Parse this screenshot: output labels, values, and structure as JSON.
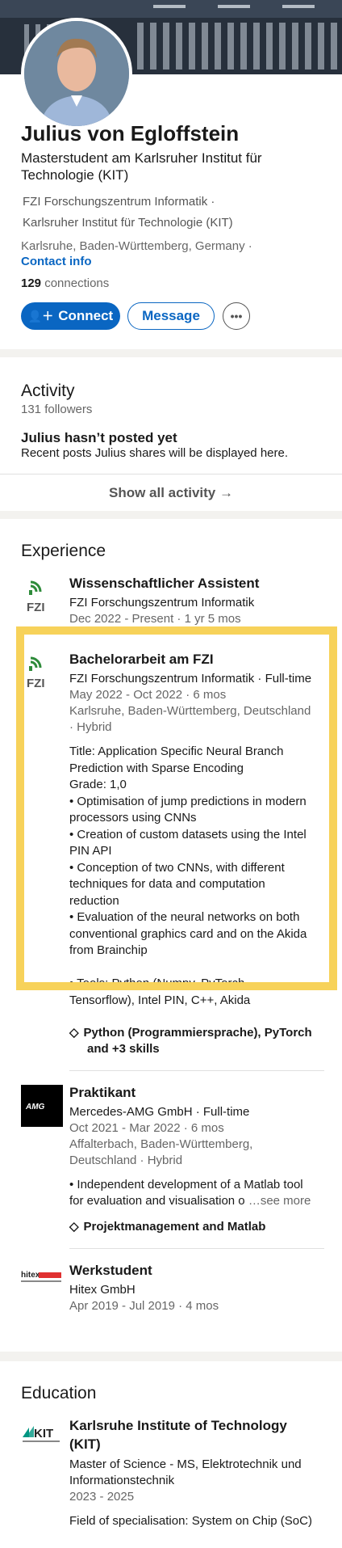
{
  "profile": {
    "name": "Julius von Egloffstein",
    "headline": "Masterstudent am Karlsruher Institut für Technologie (KIT)",
    "org1": "FZI Forschungszentrum Informatik ·",
    "org2": "Karlsruher Institut für Technologie (KIT)",
    "location": "Karlsruhe, Baden-Württemberg, Germany ·",
    "contact_info": "Contact info",
    "connections_count": "129",
    "connections_label": "connections",
    "connect_label": "Connect",
    "message_label": "Message",
    "more_label": "•••"
  },
  "activity": {
    "title": "Activity",
    "followers": "131 followers",
    "empty_title": "Julius hasn’t posted yet",
    "empty_desc": "Recent posts Julius shares will be displayed here.",
    "show_all": "Show all activity →"
  },
  "experience": {
    "title": "Experience",
    "items": [
      {
        "logo": "FZI",
        "title": "Wissenschaftlicher Assistent",
        "company": "FZI Forschungszentrum Informatik",
        "dates": "Dec 2022 - Present · 1 yr 5 mos"
      },
      {
        "logo": "FZI",
        "title": "Bachelorarbeit am FZI",
        "company": "FZI Forschungszentrum Informatik · Full-time",
        "dates": "May 2022 - Oct 2022 · 6 mos",
        "location1": "Karlsruhe, Baden-Württemberg, Deutschland",
        "location2": "· Hybrid",
        "desc": [
          "Title: Application Specific Neural Branch",
          "Prediction with Sparse Encoding",
          "Grade: 1,0",
          "• Optimisation of jump predictions in modern",
          "processors using CNNs",
          "• Creation of custom datasets using the Intel",
          "PIN API",
          "• Conception of two CNNs, with different",
          "techniques for data and computation",
          "reduction",
          "• Evaluation of the neural networks on both",
          "conventional graphics card and on the Akida",
          "from Brainchip",
          "",
          "• Tools: Python (Numpy, PyTorch,",
          "Tensorflow), Intel PIN, C++, Akida"
        ],
        "skills1": "Python (Programmiersprache), PyTorch",
        "skills2": "and +3 skills"
      },
      {
        "logo": "AMG",
        "title": "Praktikant",
        "company": "Mercedes-AMG GmbH · Full-time",
        "dates": "Oct 2021 - Mar 2022 · 6 mos",
        "location1": "Affalterbach, Baden-Württemberg,",
        "location2": "Deutschland · Hybrid",
        "desc1": "• Independent development of a Matlab tool",
        "desc2": "for evaluation and visualisation o",
        "see_more": "…see more",
        "skills": "Projektmanagement and Matlab"
      },
      {
        "logo": "hitex",
        "title": "Werkstudent",
        "company": "Hitex GmbH",
        "dates": "Apr 2019 - Jul 2019 · 4 mos"
      }
    ]
  },
  "education": {
    "title": "Education",
    "school1": "Karlsruhe Institute of Technology",
    "school2": "(KIT)",
    "degree1": "Master of Science - MS, Elektrotechnik und",
    "degree2": "Informationstechnik",
    "years": "2023 - 2025",
    "field": "Field of specialisation: System on Chip (SoC)",
    "logo": "KIT"
  },
  "colors": {
    "accent": "#0a66c2",
    "highlight": "#f7d25a"
  }
}
